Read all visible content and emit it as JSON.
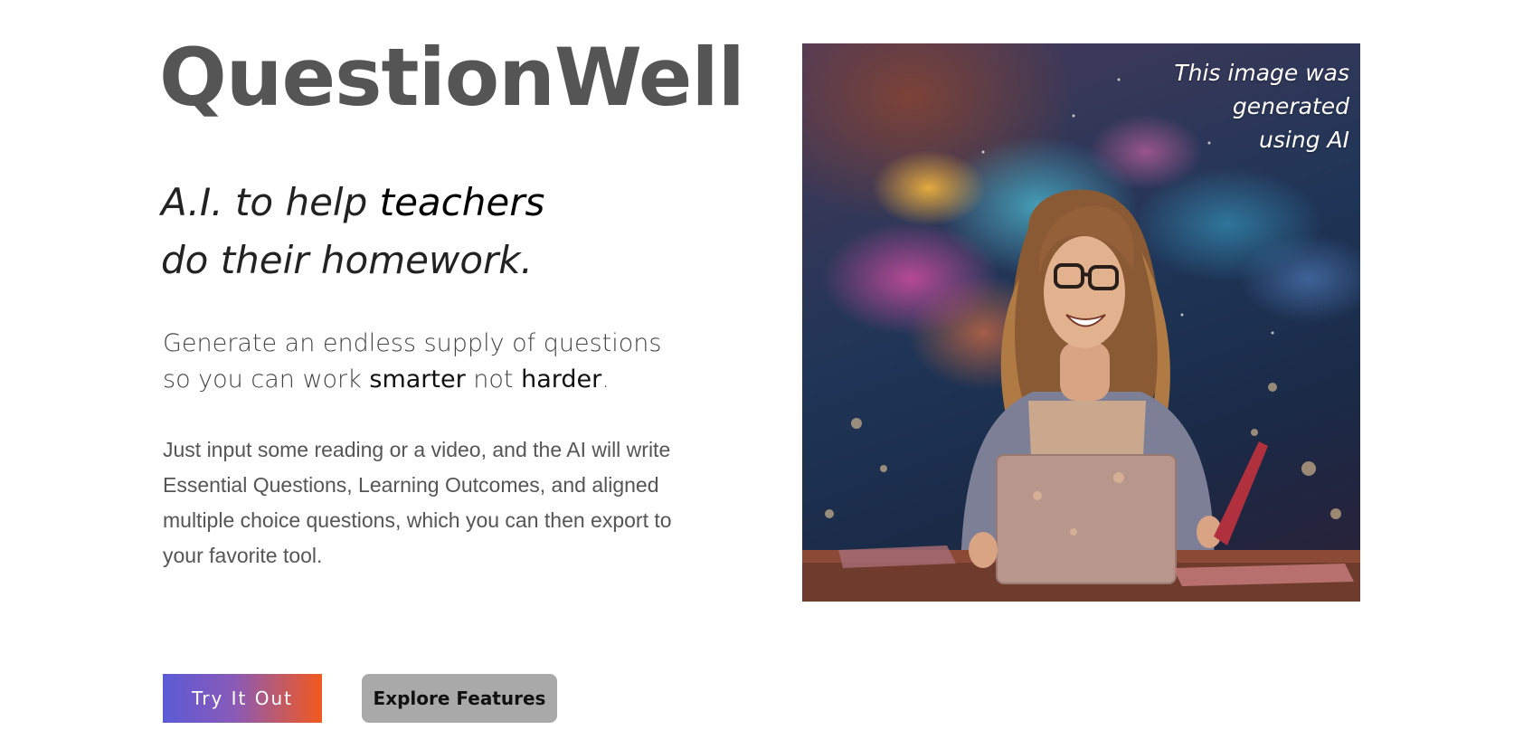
{
  "brand": {
    "name": "QuestionWell"
  },
  "tagline": {
    "line1_prefix": "A.I. to help ",
    "line1_emphasis": "teachers",
    "line2": "do their homework."
  },
  "subhead": {
    "line1": "Generate an endless supply of questions",
    "line2_prefix": "so you can work ",
    "emphasis1": "smarter",
    "middle": " not ",
    "emphasis2": "harder",
    "end": "."
  },
  "description": "Just input some reading or a video, and the AI will write Essential Questions, Learning Outcomes, and aligned multiple choice questions, which you can then export to your favorite tool.",
  "buttons": {
    "primary_label": "Try It Out",
    "secondary_label": "Explore Features"
  },
  "hero_image": {
    "alt": "Smiling teacher with glasses sitting at a desk with a laptop, in front of a colorful cosmic cloud background",
    "note_line1": "This image was",
    "note_line2": "generated",
    "note_line3": "using AI"
  },
  "colors": {
    "brand_gray": "#555555",
    "primary_gradient_start": "#5b5bd6",
    "primary_gradient_end": "#f2591d",
    "secondary_button": "#a9a9a9"
  }
}
